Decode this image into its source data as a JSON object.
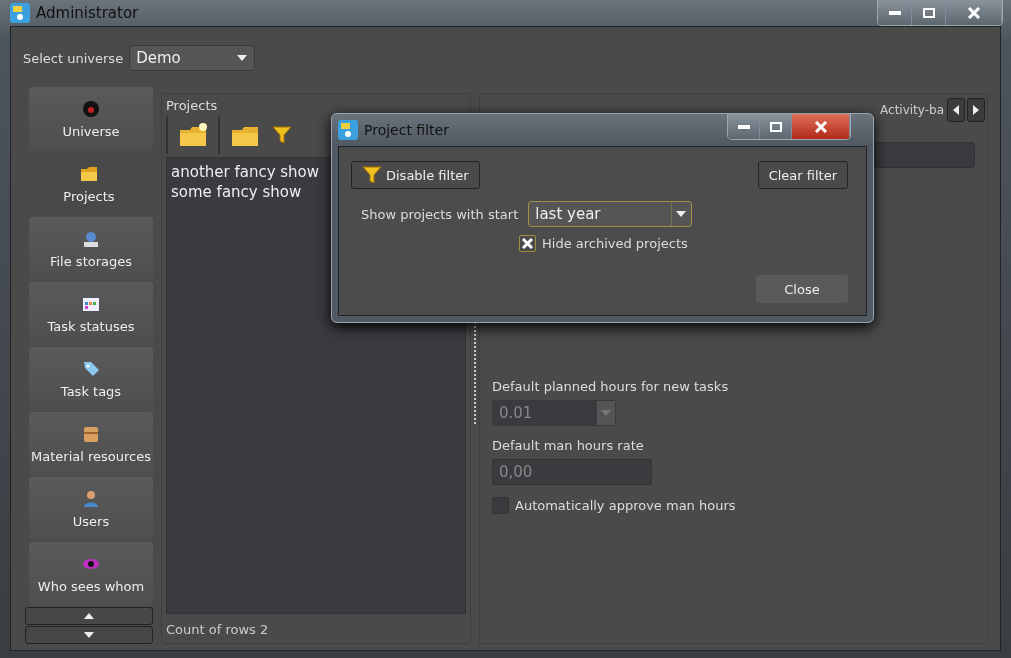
{
  "window": {
    "title": "Administrator"
  },
  "universe": {
    "label": "Select universe",
    "value": "Demo"
  },
  "sidebar": {
    "items": [
      {
        "label": "Universe",
        "selected": false
      },
      {
        "label": "Projects",
        "selected": true
      },
      {
        "label": "File storages",
        "selected": false
      },
      {
        "label": "Task statuses",
        "selected": false
      },
      {
        "label": "Task tags",
        "selected": false
      },
      {
        "label": "Material resources",
        "selected": false
      },
      {
        "label": "Users",
        "selected": false
      },
      {
        "label": "Who sees whom",
        "selected": false
      }
    ]
  },
  "projects": {
    "title": "Projects",
    "rows": [
      "another fancy show",
      "some fancy show"
    ],
    "count": "Count of rows 2"
  },
  "details": {
    "tab": "Activity-ba",
    "planned_label": "Default planned hours for new tasks",
    "planned_value": "0.01",
    "rate_label": "Default man hours rate",
    "rate_value": "0,00",
    "approve": {
      "label": "Automatically approve man hours",
      "checked": false
    }
  },
  "dialog": {
    "title": "Project filter",
    "disable_button": "Disable filter",
    "clear_button": "Clear filter",
    "start_label": "Show projects with start",
    "start_value": "last year",
    "hide_archived": {
      "label": "Hide archived projects",
      "checked": true
    },
    "close_button": "Close"
  }
}
